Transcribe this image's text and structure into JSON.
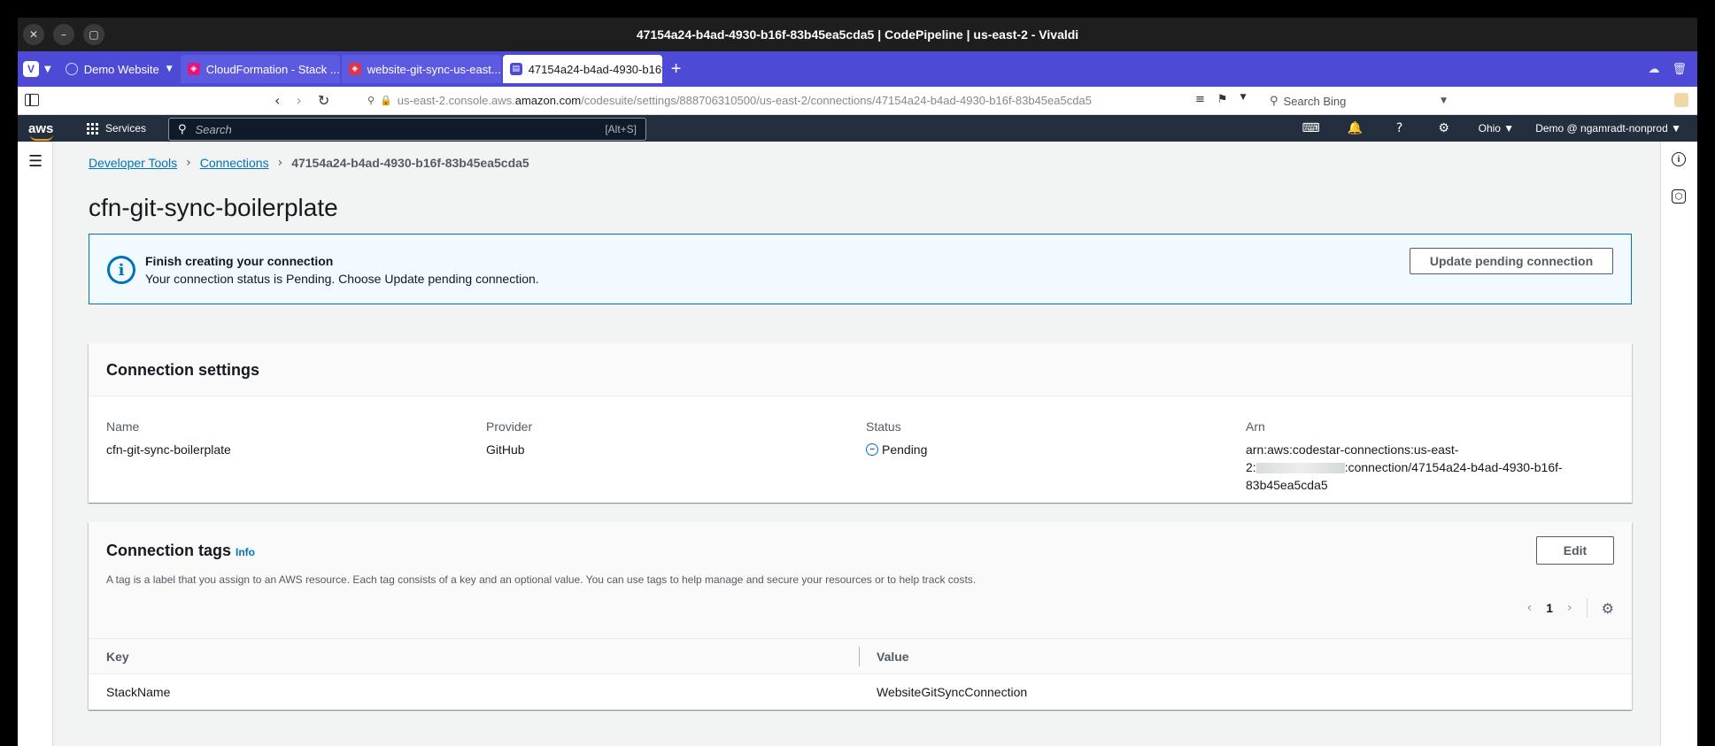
{
  "window": {
    "title": "47154a24-b4ad-4930-b16f-83b45ea5cda5 | CodePipeline | us-east-2 - Vivaldi"
  },
  "tabs": [
    {
      "label": "Demo Website",
      "icon": "globe-icon"
    },
    {
      "label": "CloudFormation - Stack ...",
      "icon": "cloudformation-icon"
    },
    {
      "label": "website-git-sync-us-east...",
      "icon": "service-icon"
    },
    {
      "label": "47154a24-b4ad-4930-b16f",
      "icon": "codepipeline-icon"
    }
  ],
  "address": {
    "url_prefix": "us-east-2.console.aws.",
    "url_host": "amazon.com",
    "url_path": "/codesuite/settings/888706310500/us-east-2/connections/47154a24-b4ad-4930-b16f-83b45ea5cda5",
    "search_placeholder": "Search Bing"
  },
  "aws_nav": {
    "logo": "aws",
    "services": "Services",
    "search_placeholder": "Search",
    "search_shortcut": "[Alt+S]",
    "region": "Ohio ▼",
    "account": "Demo @ ngamradt-nonprod ▼"
  },
  "breadcrumb": {
    "items": [
      "Developer Tools",
      "Connections"
    ],
    "current": "47154a24-b4ad-4930-b16f-83b45ea5cda5"
  },
  "page": {
    "title": "cfn-git-sync-boilerplate"
  },
  "alert": {
    "title": "Finish creating your connection",
    "message": "Your connection status is Pending. Choose Update pending connection.",
    "button": "Update pending connection"
  },
  "settings": {
    "title": "Connection settings",
    "name_label": "Name",
    "name_value": "cfn-git-sync-boilerplate",
    "provider_label": "Provider",
    "provider_value": "GitHub",
    "status_label": "Status",
    "status_value": "Pending",
    "arn_label": "Arn",
    "arn_line1": "arn:aws:codestar-connections:us-east-",
    "arn_line2_prefix": "2:",
    "arn_line2_suffix": ":connection/47154a24-b4ad-4930-b16f-",
    "arn_line3": "83b45ea5cda5"
  },
  "tags": {
    "title": "Connection tags",
    "info": "Info",
    "description": "A tag is a label that you assign to an AWS resource. Each tag consists of a key and an optional value. You can use tags to help manage and secure your resources or to help track costs.",
    "edit_button": "Edit",
    "page": "1",
    "columns": [
      "Key",
      "Value"
    ],
    "rows": [
      {
        "key": "StackName",
        "value": "WebsiteGitSyncConnection"
      }
    ]
  },
  "colors": {
    "aws_nav": "#232f3e",
    "link": "#0073bb",
    "vivaldi": "#4d4bd6",
    "alert_bg": "#f1faff"
  }
}
